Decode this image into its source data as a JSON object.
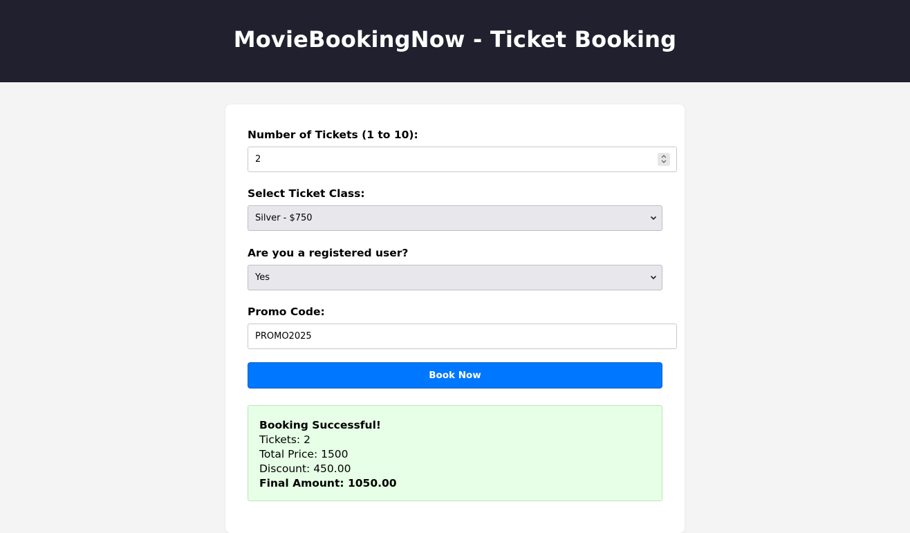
{
  "header": {
    "title": "MovieBookingNow - Ticket Booking"
  },
  "form": {
    "tickets": {
      "label": "Number of Tickets (1 to 10):",
      "value": "2"
    },
    "ticket_class": {
      "label": "Select Ticket Class:",
      "selected": "Silver - $750"
    },
    "registered": {
      "label": "Are you a registered user?",
      "selected": "Yes"
    },
    "promo": {
      "label": "Promo Code:",
      "value": "PROMO2025"
    },
    "book_label": "Book Now"
  },
  "result": {
    "heading": "Booking Successful!",
    "tickets": "Tickets: 2",
    "total": "Total Price: 1500",
    "discount": "Discount: 450.00",
    "final": "Final Amount: 1050.00"
  },
  "colors": {
    "header_bg": "#20202e",
    "button": "#0077ff",
    "success_bg": "#e6ffe6"
  }
}
